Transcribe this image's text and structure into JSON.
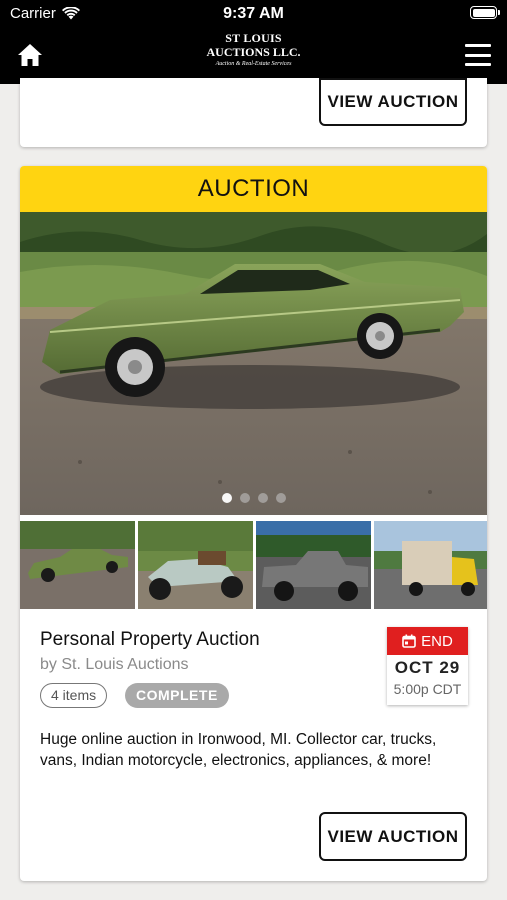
{
  "status_bar": {
    "carrier": "Carrier",
    "time": "9:37 AM"
  },
  "nav": {
    "logo_line1": "ST LOUIS",
    "logo_line2": "AUCTIONS LLC.",
    "logo_tagline": "Auction & Real-Estate Services"
  },
  "previous_card": {
    "button_label": "VIEW AUCTION"
  },
  "auction_card": {
    "banner": "AUCTION",
    "carousel": {
      "slide_count": 4,
      "active_slide": 1
    },
    "title": "Personal Property Auction",
    "byline": "by St. Louis Auctions",
    "items_count": "4 items",
    "status": "COMPLETE",
    "end_label": "END",
    "end_date": "OCT 29",
    "end_time": "5:00p CDT",
    "description": "Huge online auction in Ironwood, MI. Collector car, trucks, vans, Indian motorcycle, electronics, appliances, & more!",
    "button_label": "VIEW AUCTION"
  },
  "colors": {
    "banner": "#ffd411",
    "end_badge": "#e01f1f",
    "status_pill": "#a9a9a9"
  }
}
